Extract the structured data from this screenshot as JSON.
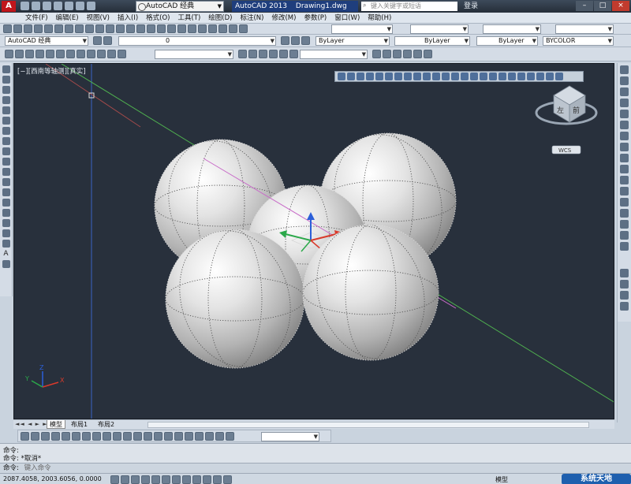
{
  "title_bar": {
    "app_logo": "A",
    "workspace_selector": "AutoCAD 经典",
    "app_name": "AutoCAD 2013",
    "document_name": "Drawing1.dwg",
    "search_placeholder": "键入关键字或短语",
    "login_label": "登录",
    "window_controls": [
      "–",
      "□",
      "×"
    ]
  },
  "menu_bar": [
    "文件(F)",
    "编辑(E)",
    "视图(V)",
    "插入(I)",
    "格式(O)",
    "工具(T)",
    "绘图(D)",
    "标注(N)",
    "修改(M)",
    "参数(P)",
    "窗口(W)",
    "帮助(H)"
  ],
  "toolbar_row2": {
    "workspace_combo": "AutoCAD 经典",
    "layer_combo": "0",
    "color_combo": "ByLayer",
    "linetype_combo": "ByLayer",
    "lineweight_combo": "ByLayer",
    "plotstyle_combo": "BYCOLOR"
  },
  "viewport": {
    "view_label": "[−][西南等轴测][真实]",
    "viewcube_face": "左",
    "viewcube_face2": "前",
    "wcs_label": "WCS"
  },
  "layout_tabs": {
    "nav": "◄◄ ◄ ► ►►",
    "tabs": [
      "模型",
      "布局1",
      "布局2"
    ],
    "active": "模型"
  },
  "command": {
    "line1": "命令:",
    "line2": "命令: *取消*",
    "prompt": "命令:",
    "placeholder": "键入命令"
  },
  "status_bar": {
    "coords": "2087.4058, 2003.6056, 0.0000",
    "model_label": "模型",
    "watermark": "系统天地"
  },
  "colors": {
    "viewport_bg": "#28303c",
    "x_axis": "#d93a2b",
    "y_axis": "#2ba84a",
    "z_axis": "#2b5fd9",
    "green_line": "#4fb04f",
    "magenta_line": "#c86bc8",
    "blue_line": "#3a64c4"
  }
}
